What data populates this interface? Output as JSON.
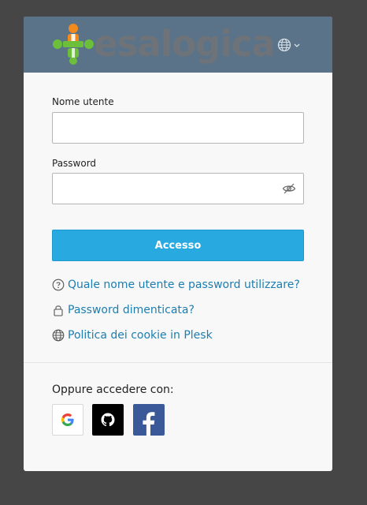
{
  "brand": {
    "name": "esalogica"
  },
  "header": {
    "language_icon": "globe-icon",
    "language_caret": "chevron-down-icon"
  },
  "form": {
    "username": {
      "label": "Nome utente",
      "value": "",
      "placeholder": ""
    },
    "password": {
      "label": "Password",
      "value": "",
      "placeholder": "",
      "toggle_icon": "eye-off-icon"
    },
    "submit_label": "Accesso"
  },
  "links": [
    {
      "icon": "question-circle-icon",
      "label": "Quale nome utente e password utilizzare?"
    },
    {
      "icon": "lock-icon",
      "label": "Password dimenticata?"
    },
    {
      "icon": "globe-icon",
      "label": "Politica dei cookie in Plesk"
    }
  ],
  "social": {
    "label": "Oppure accedere con:",
    "providers": [
      {
        "name": "google",
        "icon": "google-icon"
      },
      {
        "name": "github",
        "icon": "github-icon"
      },
      {
        "name": "facebook",
        "icon": "facebook-icon"
      }
    ]
  },
  "colors": {
    "page_bg": "#464646",
    "header_bg": "#5a7389",
    "primary": "#28aae1",
    "link": "#1c7eb0",
    "facebook": "#3b5998"
  }
}
